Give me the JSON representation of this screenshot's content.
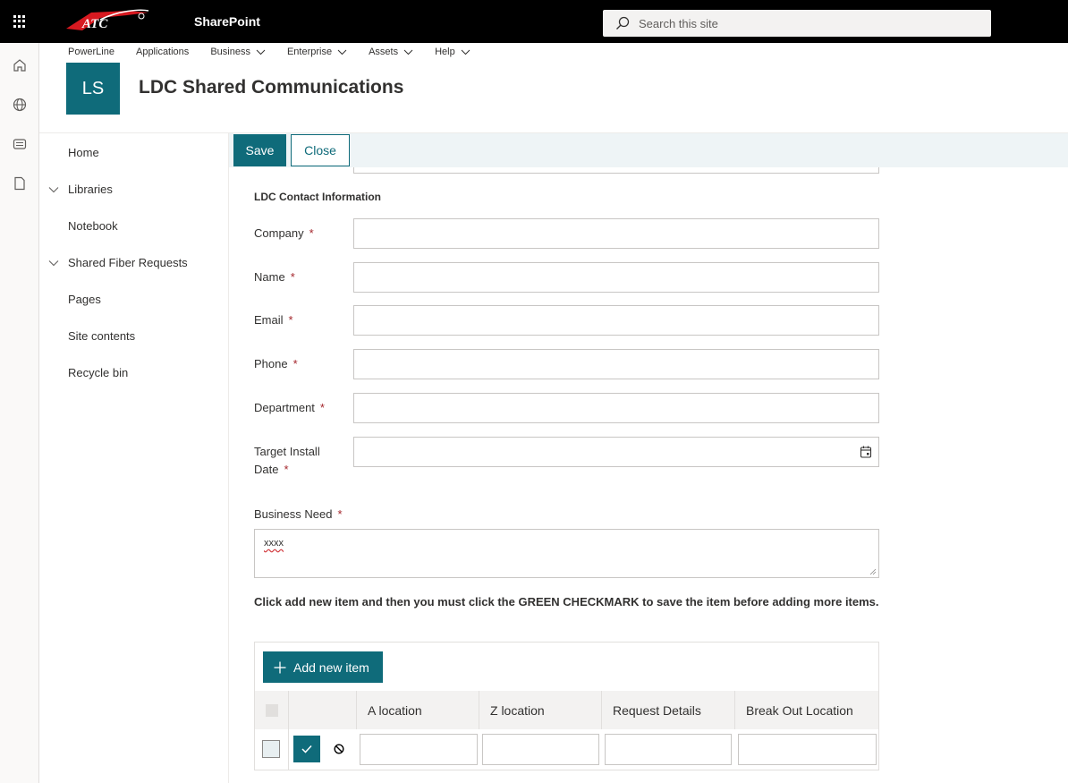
{
  "suite": {
    "app_name": "SharePoint",
    "logo_text": "ATC",
    "search_placeholder": "Search this site"
  },
  "rail": {
    "icons": [
      "home-icon",
      "globe-icon",
      "news-icon",
      "document-icon"
    ]
  },
  "site": {
    "topnav": [
      {
        "label": "PowerLine",
        "has_menu": false
      },
      {
        "label": "Applications",
        "has_menu": false
      },
      {
        "label": "Business",
        "has_menu": true
      },
      {
        "label": "Enterprise",
        "has_menu": true
      },
      {
        "label": "Assets",
        "has_menu": true
      },
      {
        "label": "Help",
        "has_menu": true
      }
    ],
    "logo_initials": "LS",
    "title": "LDC Shared Communications",
    "accent_color": "#0f6b7a"
  },
  "leftnav": {
    "items": [
      {
        "label": "Home",
        "expandable": false
      },
      {
        "label": "Libraries",
        "expandable": true
      },
      {
        "label": "Notebook",
        "expandable": false
      },
      {
        "label": "Shared Fiber Requests",
        "expandable": true
      },
      {
        "label": "Pages",
        "expandable": false
      },
      {
        "label": "Site contents",
        "expandable": false
      },
      {
        "label": "Recycle bin",
        "expandable": false
      }
    ]
  },
  "commands": {
    "save_label": "Save",
    "close_label": "Close"
  },
  "form": {
    "section_title": "LDC Contact Information",
    "required_mark": "*",
    "fields": {
      "company": {
        "label": "Company",
        "value": ""
      },
      "name": {
        "label": "Name",
        "value": ""
      },
      "email": {
        "label": "Email",
        "value": ""
      },
      "phone": {
        "label": "Phone",
        "value": ""
      },
      "department": {
        "label": "Department",
        "value": ""
      },
      "target_date_line1": "Target Install",
      "target_date_line2": "Date",
      "target_date_value": ""
    },
    "business_need": {
      "label": "Business Need",
      "value": "xxxx"
    },
    "instruction": "Click add new item and then you must click the GREEN CHECKMARK to save the item before adding more items."
  },
  "repeating_table": {
    "add_label": "Add new item",
    "columns": [
      "A location",
      "Z location",
      "Request Details",
      "Break Out Location"
    ],
    "row": {
      "a_location": "",
      "z_location": "",
      "request_details": "",
      "break_out_location": ""
    }
  }
}
